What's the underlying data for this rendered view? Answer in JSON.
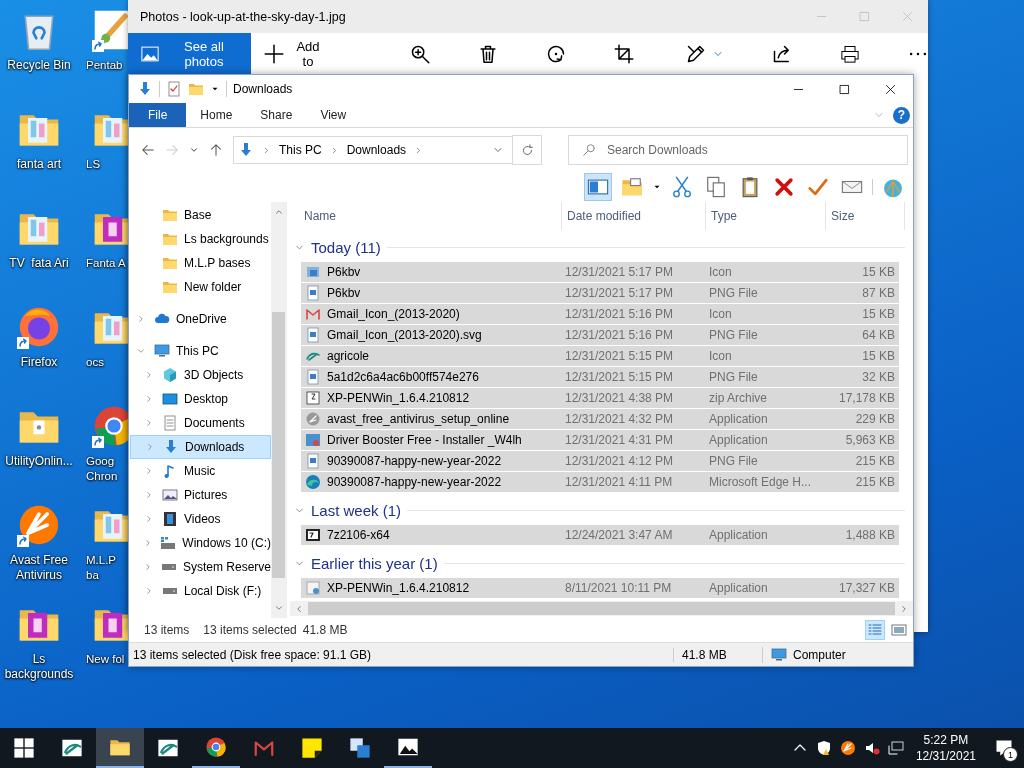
{
  "desktop": {
    "columns": [
      [
        {
          "label": "Recycle Bin",
          "kind": "recycle",
          "shortcut": false
        },
        {
          "label": "fanta art",
          "kind": "folderArt",
          "shortcut": false
        },
        {
          "label": "TV  fata Ari",
          "kind": "folderArt",
          "shortcut": false
        },
        {
          "label": "Firefox",
          "kind": "fox",
          "shortcut": true
        },
        {
          "label": "UtilityOnlin...",
          "kind": "folderDoc",
          "shortcut": false
        },
        {
          "label": "Avast Free Antivirus",
          "kind": "avast",
          "shortcut": true
        },
        {
          "label": "Ls backgrounds",
          "kind": "folderPink",
          "shortcut": false
        }
      ],
      [
        {
          "label": "Pentab",
          "kind": "pentab",
          "shortcut": true
        },
        {
          "label": "LS",
          "kind": "folderArt",
          "shortcut": false
        },
        {
          "label": "Fanta A",
          "kind": "folderPink",
          "shortcut": false
        },
        {
          "label": "ocs",
          "kind": "folderArt",
          "shortcut": false
        },
        {
          "label": "Goog Chron",
          "kind": "chrome",
          "shortcut": true
        },
        {
          "label": "M.L.P ba",
          "kind": "folderArt",
          "shortcut": false
        },
        {
          "label": "New fol",
          "kind": "folderPink",
          "shortcut": false
        }
      ]
    ]
  },
  "photos": {
    "title": "Photos - look-up-at-the-sky-day-1.jpg",
    "see_all": "See all photos",
    "add_to": "Add to"
  },
  "explorer": {
    "title": "Downloads",
    "help": "?",
    "tabs": [
      {
        "label": "File",
        "kind": "menu",
        "selected": false
      },
      {
        "label": "Home",
        "kind": "tab",
        "selected": false
      },
      {
        "label": "Share",
        "kind": "tab",
        "selected": false
      },
      {
        "label": "View",
        "kind": "tab",
        "selected": false
      }
    ],
    "address": [
      "This PC",
      "Downloads"
    ],
    "search": {
      "placeholder": "Search Downloads"
    },
    "toolbar": [
      {
        "kind": "preview",
        "on": true
      },
      {
        "kind": "newfolder",
        "on": false
      },
      {
        "kind": "cut",
        "on": false
      },
      {
        "kind": "copy",
        "on": false
      },
      {
        "kind": "paste",
        "on": false
      },
      {
        "kind": "delete",
        "on": false
      },
      {
        "kind": "check",
        "on": false
      },
      {
        "kind": "envelope",
        "on": false
      },
      {
        "kind": "shell",
        "on": false
      }
    ],
    "nav": {
      "quick_access": [
        {
          "label": "Base",
          "kind": "folder",
          "selected": false
        },
        {
          "label": "Ls backgrounds",
          "kind": "folder",
          "selected": false
        },
        {
          "label": "M.L.P bases",
          "kind": "folder",
          "selected": false
        },
        {
          "label": "New folder",
          "kind": "folder",
          "selected": false
        }
      ],
      "items": [
        {
          "label": "OneDrive",
          "kind": "cloud",
          "expanded": false,
          "selected": false
        },
        {
          "label": "This PC",
          "kind": "pc",
          "expanded": true,
          "selected": false,
          "children": [
            {
              "label": "3D Objects",
              "kind": "cube",
              "expanded": false,
              "selected": false
            },
            {
              "label": "Desktop",
              "kind": "screen",
              "expanded": false,
              "selected": false
            },
            {
              "label": "Documents",
              "kind": "documents",
              "expanded": false,
              "selected": false
            },
            {
              "label": "Downloads",
              "kind": "download",
              "expanded": false,
              "selected": true
            },
            {
              "label": "Music",
              "kind": "music",
              "expanded": false,
              "selected": false
            },
            {
              "label": "Pictures",
              "kind": "pictures",
              "expanded": false,
              "selected": false
            },
            {
              "label": "Videos",
              "kind": "videos",
              "expanded": false,
              "selected": false
            },
            {
              "label": "Windows 10 (C:)",
              "kind": "windrive",
              "expanded": false,
              "selected": false
            },
            {
              "label": "System Reserve",
              "kind": "drive",
              "expanded": false,
              "selected": false
            },
            {
              "label": "Local Disk (F:)",
              "kind": "drive",
              "expanded": false,
              "selected": false
            }
          ]
        }
      ]
    },
    "columns": [
      "Name",
      "Date modified",
      "Type",
      "Size"
    ],
    "groups": [
      {
        "label": "Today (11)",
        "expanded": true,
        "rows": [
          {
            "name": "P6kbv",
            "date": "12/31/2021 5:17 PM",
            "type": "Icon",
            "size": "15 KB",
            "kind": "icon",
            "selected": true
          },
          {
            "name": "P6kbv",
            "date": "12/31/2021 5:17 PM",
            "type": "PNG File",
            "size": "87 KB",
            "kind": "png",
            "selected": true
          },
          {
            "name": "Gmail_Icon_(2013-2020)",
            "date": "12/31/2021 5:16 PM",
            "type": "Icon",
            "size": "15 KB",
            "kind": "mail",
            "selected": true
          },
          {
            "name": "Gmail_Icon_(2013-2020).svg",
            "date": "12/31/2021 5:16 PM",
            "type": "PNG File",
            "size": "64 KB",
            "kind": "png",
            "selected": true
          },
          {
            "name": "agricole",
            "date": "12/31/2021 5:15 PM",
            "type": "Icon",
            "size": "15 KB",
            "kind": "ca",
            "selected": true
          },
          {
            "name": "5a1d2c6a4ac6b00ff574e276",
            "date": "12/31/2021 5:15 PM",
            "type": "PNG File",
            "size": "32 KB",
            "kind": "png",
            "selected": true
          },
          {
            "name": "XP-PENWin_1.6.4.210812",
            "date": "12/31/2021 4:38 PM",
            "type": "zip Archive",
            "size": "17,178 KB",
            "kind": "zip",
            "selected": true
          },
          {
            "name": "avast_free_antivirus_setup_online",
            "date": "12/31/2021 4:32 PM",
            "type": "Application",
            "size": "229 KB",
            "kind": "avastFile",
            "selected": true
          },
          {
            "name": "Driver Booster Free - Installer _W4lh",
            "date": "12/31/2021 4:31 PM",
            "type": "Application",
            "size": "5,963 KB",
            "kind": "booster",
            "selected": true
          },
          {
            "name": "90390087-happy-new-year-2022",
            "date": "12/31/2021 4:12 PM",
            "type": "PNG File",
            "size": "215 KB",
            "kind": "png",
            "selected": true
          },
          {
            "name": "90390087-happy-new-year-2022",
            "date": "12/31/2021 4:11 PM",
            "type": "Microsoft Edge H...",
            "size": "215 KB",
            "kind": "edge",
            "selected": true
          }
        ]
      },
      {
        "label": "Last week (1)",
        "expanded": true,
        "rows": [
          {
            "name": "7z2106-x64",
            "date": "12/24/2021 3:47 AM",
            "type": "Application",
            "size": "1,488 KB",
            "kind": "sevenz",
            "selected": true
          }
        ]
      },
      {
        "label": "Earlier this year (1)",
        "expanded": true,
        "rows": [
          {
            "name": "XP-PENWin_1.6.4.210812",
            "date": "8/11/2021 10:11 PM",
            "type": "Application",
            "size": "17,327 KB",
            "kind": "setup",
            "selected": true
          }
        ]
      }
    ],
    "status": {
      "count": "13 items",
      "selected": "13 items selected",
      "size": "41.8 MB"
    },
    "views": [
      {
        "kind": "details",
        "selected": true
      },
      {
        "kind": "tiles",
        "selected": false
      }
    ],
    "status_bar": {
      "info": "13 items selected (Disk free space: 91.1 GB)",
      "size": "41.8 MB",
      "location": "Computer"
    }
  },
  "taskbar": {
    "apps": [
      {
        "kind": "logo",
        "running": false,
        "active": false
      },
      {
        "kind": "folder",
        "running": true,
        "active": true
      },
      {
        "kind": "logo",
        "running": false,
        "active": false
      },
      {
        "kind": "chrome",
        "running": true,
        "active": false
      },
      {
        "kind": "mail",
        "running": false,
        "active": false
      },
      {
        "kind": "note",
        "running": false,
        "active": false
      },
      {
        "kind": "translate",
        "running": false,
        "active": false
      },
      {
        "kind": "photo",
        "running": true,
        "active": false
      }
    ],
    "time": "5:22 PM",
    "date": "12/31/2021",
    "notifications": "1"
  }
}
